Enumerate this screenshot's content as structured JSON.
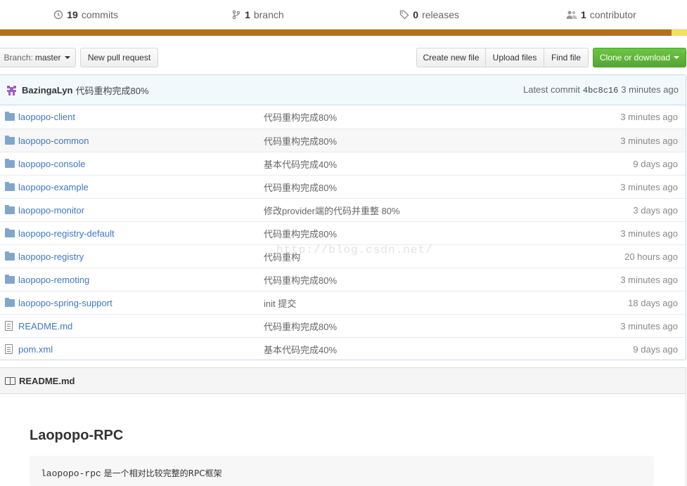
{
  "summary": {
    "commits": {
      "count": "19",
      "label": "commits"
    },
    "branches": {
      "count": "1",
      "label": "branch"
    },
    "releases": {
      "count": "0",
      "label": "releases"
    },
    "contributors": {
      "count": "1",
      "label": "contributor"
    }
  },
  "language_bar": {
    "colors": [
      "#b07219",
      "#f1e05a"
    ],
    "shares": [
      0.977,
      0.023
    ]
  },
  "toolbar": {
    "branch_prefix": "Branch:",
    "branch_name": "master",
    "new_pull_request": "New pull request",
    "create_new_file": "Create new file",
    "upload_files": "Upload files",
    "find_file": "Find file",
    "clone_or_download": "Clone or download"
  },
  "latest_commit": {
    "author": "BazingaLyn",
    "message": "代码重构完成80%",
    "prefix": "Latest commit",
    "sha": "4bc8c16",
    "age": "3 minutes ago"
  },
  "files": [
    {
      "type": "folder",
      "name": "laopopo-client",
      "message": "代码重构完成80%",
      "age": "3 minutes ago"
    },
    {
      "type": "folder",
      "name": "laopopo-common",
      "message": "代码重构完成80%",
      "age": "3 minutes ago"
    },
    {
      "type": "folder",
      "name": "laopopo-console",
      "message": "基本代码完成40%",
      "age": "9 days ago"
    },
    {
      "type": "folder",
      "name": "laopopo-example",
      "message": "代码重构完成80%",
      "age": "3 minutes ago"
    },
    {
      "type": "folder",
      "name": "laopopo-monitor",
      "message": "修改provider端的代码并重整 80%",
      "age": "3 days ago"
    },
    {
      "type": "folder",
      "name": "laopopo-registry-default",
      "message": "代码重构完成80%",
      "age": "3 minutes ago"
    },
    {
      "type": "folder",
      "name": "laopopo-registry",
      "message": "代码重构",
      "age": "20 hours ago"
    },
    {
      "type": "folder",
      "name": "laopopo-remoting",
      "message": "代码重构完成80%",
      "age": "3 minutes ago"
    },
    {
      "type": "folder",
      "name": "laopopo-spring-support",
      "message": "init 提交",
      "age": "18 days ago"
    },
    {
      "type": "file",
      "name": "README.md",
      "message": "代码重构完成80%",
      "age": "3 minutes ago"
    },
    {
      "type": "file",
      "name": "pom.xml",
      "message": "基本代码完成40%",
      "age": "9 days ago"
    }
  ],
  "watermark": "http://blog.csdn.net/",
  "readme": {
    "header": "README.md",
    "title": "Laopopo-RPC",
    "code_prefix": "laopopo-rpc",
    "code_rest": " 是一个相对比较完整的RPC框架"
  },
  "colors": {
    "link": "#4078c0",
    "green": "#6cc644",
    "commit_bg": "#f2f9fc"
  }
}
